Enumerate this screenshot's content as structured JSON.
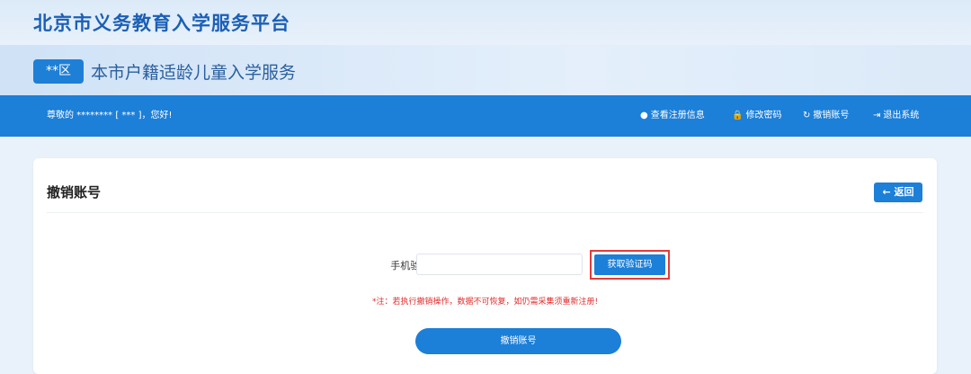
{
  "header": {
    "platform_title": "北京市义务教育入学服务平台",
    "district_badge": "**区",
    "service_title": "本市户籍适龄儿童入学服务"
  },
  "navbar": {
    "greeting": "尊敬的 ******** [ *** ]，您好!",
    "items": [
      {
        "icon": "info-circle-icon",
        "glyph": "●",
        "label": "查看注册信息"
      },
      {
        "icon": "lock-icon",
        "glyph": "🔒",
        "label": "修改密码"
      },
      {
        "icon": "refresh-icon",
        "glyph": "↻",
        "label": "撤销账号"
      },
      {
        "icon": "logout-icon",
        "glyph": "⇥",
        "label": "退出系统"
      }
    ]
  },
  "card": {
    "title": "撤销账号",
    "back_label": "← 返回",
    "field_label": "手机验证码:",
    "input_value": "",
    "input_placeholder": "",
    "get_code_label": "获取验证码",
    "warning": "*注：若执行撤销操作，数据不可恢复，如仍需采集须重新注册!",
    "submit_label": "撤销账号"
  },
  "colors": {
    "primary": "#1c7fd8",
    "title_blue": "#1b5fb5",
    "warning_red": "#e02b2b",
    "highlight_red": "#e23b3b"
  }
}
